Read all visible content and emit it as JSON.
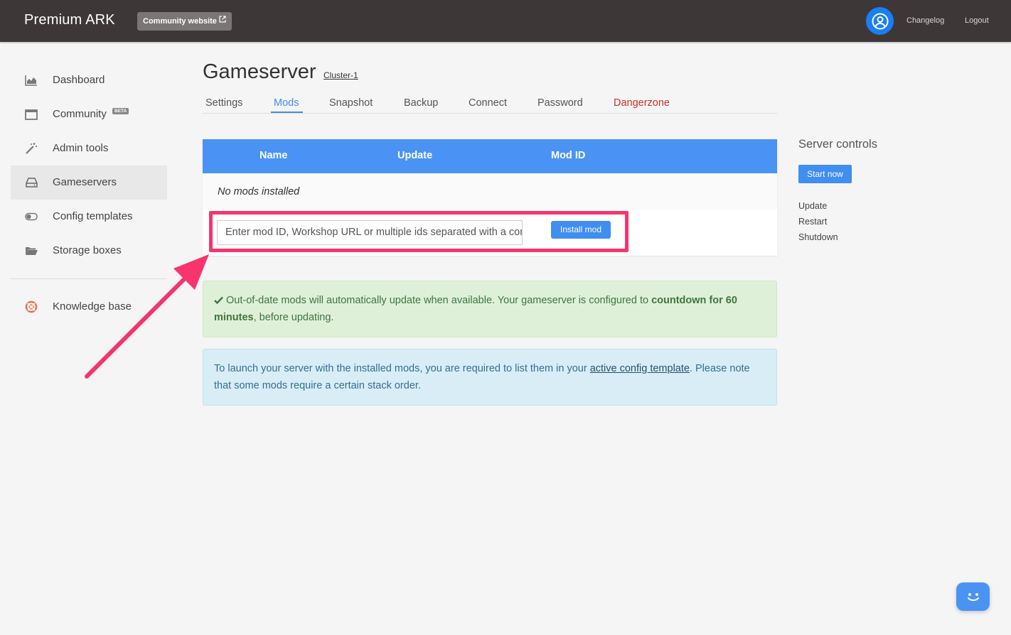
{
  "app": {
    "brand": "Premium ARK",
    "community_website": "Community website",
    "changelog": "Changelog",
    "logout": "Logout"
  },
  "sidebar": {
    "items": [
      {
        "label": "Dashboard",
        "icon": "area-chart-icon"
      },
      {
        "label": "Community",
        "icon": "window-icon",
        "badge": "BETA"
      },
      {
        "label": "Admin tools",
        "icon": "magic-wand-icon"
      },
      {
        "label": "Gameservers",
        "icon": "hdd-icon",
        "active": true
      },
      {
        "label": "Config templates",
        "icon": "toggle-icon"
      },
      {
        "label": "Storage boxes",
        "icon": "folder-open-icon"
      },
      {
        "label": "Knowledge base",
        "icon": "life-ring-icon"
      }
    ]
  },
  "header": {
    "title": "Gameserver",
    "cluster": "Cluster-1"
  },
  "tabs": [
    {
      "label": "Settings"
    },
    {
      "label": "Mods",
      "active": true
    },
    {
      "label": "Snapshot"
    },
    {
      "label": "Backup"
    },
    {
      "label": "Connect"
    },
    {
      "label": "Password"
    },
    {
      "label": "Dangerzone",
      "danger": true
    }
  ],
  "mods_table": {
    "columns": [
      "Name",
      "Update",
      "Mod ID"
    ],
    "empty_text": "No mods installed",
    "input_placeholder": "Enter mod ID, Workshop URL or multiple ids separated with a comma",
    "install_label": "Install mod"
  },
  "alerts": {
    "success": {
      "text_1": "Out-of-date mods will automatically update when available. Your gameserver is configured to ",
      "bold": "countdown for 60 minutes",
      "text_2": ", before updating."
    },
    "info": {
      "text_1": "To launch your server with the installed mods, you are required to list them in your ",
      "link": "active config template",
      "text_2": ". Please note that some mods require a certain stack order."
    }
  },
  "server_controls": {
    "title": "Server controls",
    "start_label": "Start now",
    "actions": [
      "Update",
      "Restart",
      "Shutdown"
    ]
  },
  "colors": {
    "accent": "#3f8ef0",
    "topbar": "#3d3837",
    "danger": "#c9302c",
    "highlight": "#f7346e"
  }
}
